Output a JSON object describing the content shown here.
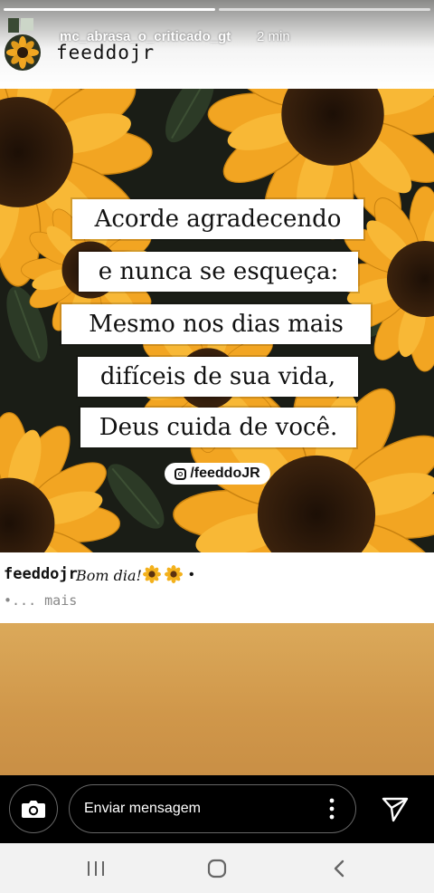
{
  "story": {
    "username": "mc_abrasa_o_criticado_gt",
    "time": "2 min",
    "post_author": "feeddojr",
    "progress": [
      1,
      0
    ]
  },
  "quote": {
    "lines": [
      "Acorde agradecendo",
      "e nunca se esqueça:",
      "Mesmo nos dias mais",
      "difíceis de sua vida,",
      "Deus cuida de você."
    ],
    "handle": "/feeddoJR"
  },
  "caption": {
    "author": "feeddojr",
    "text": "Bom dia!",
    "emoji": [
      "sunflower-emoji",
      "sunflower-emoji"
    ],
    "separator": "•",
    "more": "•... mais"
  },
  "reply": {
    "placeholder": "Enviar mensagem"
  },
  "icons": {
    "camera": "camera-icon",
    "more": "more-vertical-icon",
    "send": "send-icon",
    "recents": "recents-icon",
    "home": "home-icon",
    "back": "back-icon"
  },
  "colors": {
    "story_background": "#d6a04c",
    "petal": "#f3a824",
    "reply_bar": "#000000",
    "nav_bar": "#f2f2f2"
  }
}
